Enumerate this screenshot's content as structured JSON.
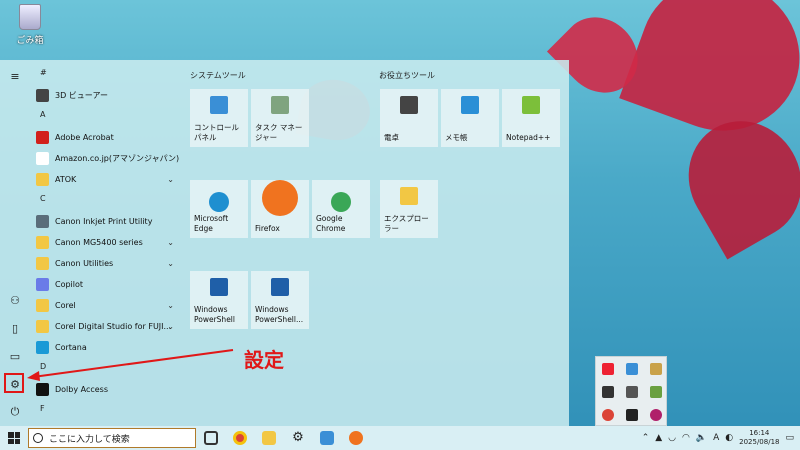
{
  "desktop": {
    "recycle_bin_label": "ごみ箱"
  },
  "start_menu": {
    "app_list": [
      {
        "type": "header",
        "text": "#"
      },
      {
        "type": "app",
        "label": "3D ビューアー",
        "icon": "cube-icon",
        "color": "#444"
      },
      {
        "type": "header",
        "text": "A"
      },
      {
        "type": "app",
        "label": "Adobe Acrobat",
        "icon": "acrobat-icon",
        "color": "#d2201b"
      },
      {
        "type": "app",
        "label": "Amazon.co.jp(アマゾンジャパン) :...",
        "icon": "amazon-icon",
        "color": "#fff"
      },
      {
        "type": "folder",
        "label": "ATOK",
        "icon": "folder-icon",
        "expand": "⌄"
      },
      {
        "type": "header",
        "text": "C"
      },
      {
        "type": "app",
        "label": "Canon Inkjet Print Utility",
        "icon": "printer-icon",
        "color": "#5a6d7a"
      },
      {
        "type": "folder",
        "label": "Canon MG5400 series",
        "icon": "folder-icon",
        "expand": "⌄"
      },
      {
        "type": "folder",
        "label": "Canon Utilities",
        "icon": "folder-icon",
        "expand": "⌄"
      },
      {
        "type": "app",
        "label": "Copilot",
        "icon": "copilot-icon",
        "color": "#6a7be8"
      },
      {
        "type": "folder",
        "label": "Corel",
        "icon": "folder-icon",
        "expand": "⌄"
      },
      {
        "type": "folder",
        "label": "Corel Digital Studio for FUJI...",
        "icon": "folder-icon",
        "expand": "⌄"
      },
      {
        "type": "app",
        "label": "Cortana",
        "icon": "cortana-icon",
        "color": "#1a9ad6"
      },
      {
        "type": "header",
        "text": "D"
      },
      {
        "type": "app",
        "label": "Dolby Access",
        "icon": "dolby-icon",
        "color": "#111"
      },
      {
        "type": "header",
        "text": "F"
      }
    ],
    "groups": [
      {
        "title": "システムツール"
      },
      {
        "title": "お役立ちツール"
      }
    ],
    "tiles": [
      {
        "label": "コントロール パネル",
        "icon": "control-panel-icon",
        "color": "#3a8fd6",
        "group": 0
      },
      {
        "label": "タスク マネージャー",
        "icon": "task-manager-icon",
        "color": "#7fa47f",
        "group": 0
      },
      {
        "label": "Microsoft Edge",
        "icon": "edge-icon",
        "color": "#1e8fd0",
        "group": 0
      },
      {
        "label": "Firefox",
        "icon": "firefox-icon",
        "color": "#f0731f",
        "group": 0
      },
      {
        "label": "Google Chrome",
        "icon": "chrome-icon",
        "color": "#3aa757",
        "group": 0
      },
      {
        "label": "Windows PowerShell",
        "icon": "powershell-icon",
        "color": "#1f5fa8",
        "group": 0
      },
      {
        "label": "Windows PowerShell...",
        "icon": "powershell-icon",
        "color": "#1f5fa8",
        "group": 0
      },
      {
        "label": "電卓",
        "icon": "calculator-icon",
        "color": "#444",
        "group": 1
      },
      {
        "label": "メモ帳",
        "icon": "notepad-icon",
        "color": "#2a8fd6",
        "group": 1
      },
      {
        "label": "Notepad++",
        "icon": "notepadpp-icon",
        "color": "#7cbf3a",
        "group": 1
      },
      {
        "label": "エクスプローラー",
        "icon": "explorer-icon",
        "color": "#f2c744",
        "group": 1
      }
    ]
  },
  "annotation": {
    "text": "設定",
    "color": "#e01818"
  },
  "taskbar": {
    "search_placeholder": "ここに入力して検索",
    "ime": "A",
    "clock_time": "16:14",
    "clock_date": "2025/08/18"
  }
}
